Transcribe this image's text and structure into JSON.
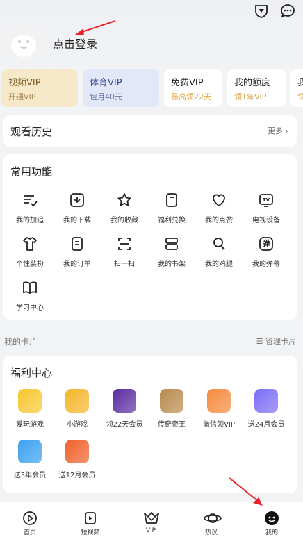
{
  "header": {
    "login_label": "点击登录"
  },
  "vip_cards": [
    {
      "title": "视频VIP",
      "sub": "开通VIP",
      "bg": "#f6e9c9",
      "title_color": "#7a5a22",
      "sub_color": "#a98850"
    },
    {
      "title": "体育VIP",
      "sub": "包月40元",
      "bg": "#e3e8f8",
      "title_color": "#3b4f9a",
      "sub_color": "#6b78a8"
    },
    {
      "title": "免费VIP",
      "sub": "最高领22天",
      "bg": "#ffffff",
      "title_color": "#222222",
      "sub_color": "#e0a340"
    },
    {
      "title": "我的额度",
      "sub": "领1年VIP",
      "bg": "#ffffff",
      "title_color": "#222222",
      "sub_color": "#e0a340"
    },
    {
      "title": "我",
      "sub": "领",
      "bg": "#ffffff",
      "title_color": "#222222",
      "sub_color": "#e0a340"
    }
  ],
  "history": {
    "title": "观看历史",
    "more": "更多"
  },
  "common": {
    "title": "常用功能",
    "items": [
      {
        "label": "我的加追",
        "icon": "list-check-icon"
      },
      {
        "label": "我的下载",
        "icon": "download-icon"
      },
      {
        "label": "我的收藏",
        "icon": "star-icon"
      },
      {
        "label": "福利兑换",
        "icon": "voucher-icon"
      },
      {
        "label": "我的点赞",
        "icon": "heart-icon"
      },
      {
        "label": "电视设备",
        "icon": "tv-icon"
      },
      {
        "label": "个性装扮",
        "icon": "tshirt-icon"
      },
      {
        "label": "我的订单",
        "icon": "order-icon"
      },
      {
        "label": "扫一扫",
        "icon": "scan-icon"
      },
      {
        "label": "我的书架",
        "icon": "bookshelf-icon"
      },
      {
        "label": "我的鸡腿",
        "icon": "drumstick-icon"
      },
      {
        "label": "我的弹幕",
        "icon": "danmaku-icon"
      },
      {
        "label": "学习中心",
        "icon": "book-icon"
      }
    ],
    "danmaku_glyph": "弹"
  },
  "cards_section": {
    "title": "我的卡片",
    "manage": "管理卡片"
  },
  "welfare": {
    "title": "福利中心",
    "items": [
      {
        "label": "爱玩游戏",
        "icon": "game-app-icon",
        "color": "#f7c62e"
      },
      {
        "label": "小游戏",
        "icon": "mini-game-app-icon",
        "color": "#f5b52a"
      },
      {
        "label": "领22天会员",
        "icon": "play-app-icon",
        "color": "#5a2ba0"
      },
      {
        "label": "传奇帝王",
        "icon": "emperor-app-icon",
        "color": "#b88a4c"
      },
      {
        "label": "微信领VIP",
        "icon": "wechat-vip-app-icon",
        "color": "#f58a3c"
      },
      {
        "label": "送24月会员",
        "icon": "vip-24-app-icon",
        "color": "#7c6cf5"
      },
      {
        "label": "送3年会员",
        "icon": "free-member-app-icon",
        "color": "#3aa0f0"
      },
      {
        "label": "送12月会员",
        "icon": "member-12-app-icon",
        "color": "#f0602a"
      }
    ]
  },
  "tabbar": [
    {
      "label": "首页",
      "icon": "home-play-icon"
    },
    {
      "label": "短视频",
      "icon": "short-video-icon"
    },
    {
      "label": "VIP",
      "icon": "vip-crown-icon"
    },
    {
      "label": "热议",
      "icon": "planet-icon"
    },
    {
      "label": "我的",
      "icon": "profile-face-icon"
    }
  ],
  "accent": "#e8232b"
}
